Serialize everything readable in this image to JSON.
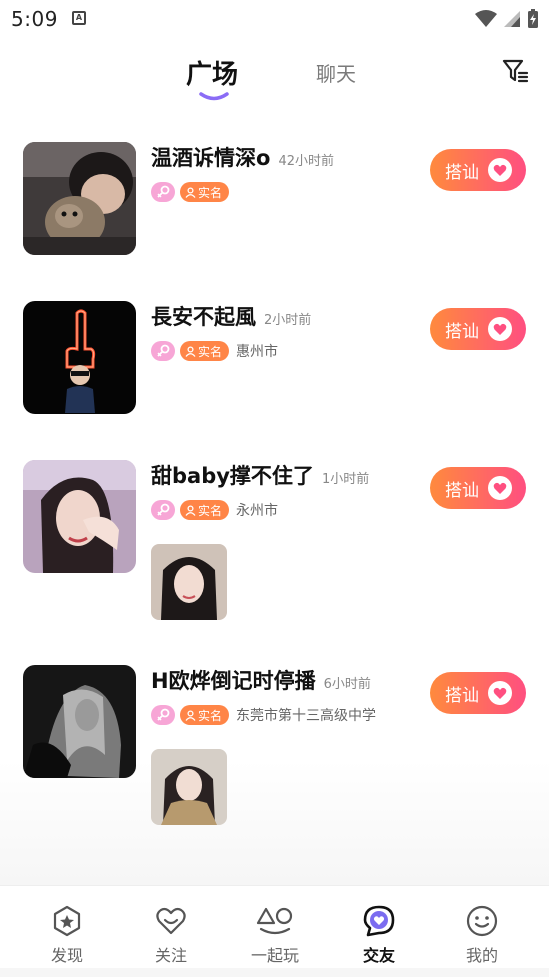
{
  "status_bar": {
    "time": "5:09",
    "notification": "A"
  },
  "header": {
    "tabs": [
      {
        "label": "广场",
        "active": true
      },
      {
        "label": "聊天",
        "active": false
      }
    ],
    "filter_icon": "filter-icon",
    "accent": "#8b6cf6"
  },
  "feed": [
    {
      "name": "温酒诉情深o",
      "time": "42小时前",
      "sex_icon": "female-icon",
      "verified": "实名",
      "city": "",
      "button": "搭讪",
      "has_photo": false
    },
    {
      "name": "長安不起風",
      "time": "2小时前",
      "sex_icon": "female-icon",
      "verified": "实名",
      "city": "惠州市",
      "button": "搭讪",
      "has_photo": false
    },
    {
      "name": "甜baby撑不住了",
      "time": "1小时前",
      "sex_icon": "female-icon",
      "verified": "实名",
      "city": "永州市",
      "button": "搭讪",
      "has_photo": true
    },
    {
      "name": "H欧烨倒记时停播",
      "time": "6小时前",
      "sex_icon": "female-icon",
      "verified": "实名",
      "city": "东莞市第十三高级中学",
      "button": "搭讪",
      "has_photo": true
    }
  ],
  "colors": {
    "button_start": "#ff8a3d",
    "button_end": "#ff4f80",
    "verified": "#ff8547",
    "female_badge": "#f7a6d6"
  },
  "bottom_nav": [
    {
      "label": "发现",
      "icon": "discover-icon",
      "active": false
    },
    {
      "label": "关注",
      "icon": "follow-icon",
      "active": false
    },
    {
      "label": "一起玩",
      "icon": "play-together-icon",
      "active": false
    },
    {
      "label": "交友",
      "icon": "friends-icon",
      "active": true
    },
    {
      "label": "我的",
      "icon": "profile-icon",
      "active": false
    }
  ]
}
